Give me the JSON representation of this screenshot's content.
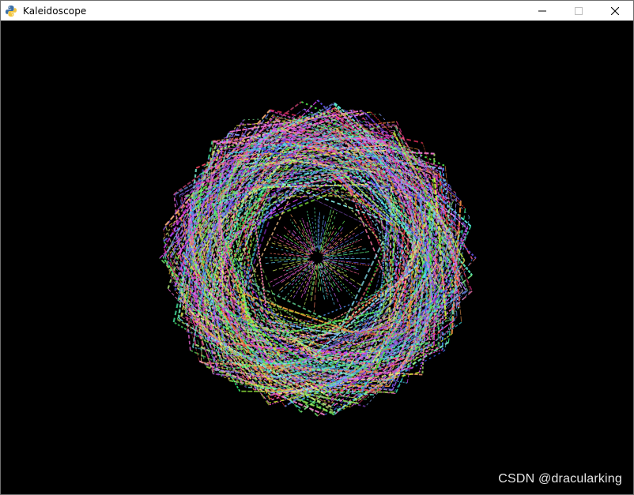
{
  "window": {
    "title": "Kaleidoscope",
    "app_icon": "python-snake-icon",
    "controls": {
      "minimize_icon": "minimize-icon",
      "maximize_icon": "maximize-icon",
      "close_icon": "close-icon"
    }
  },
  "canvas": {
    "background": "#000000",
    "pattern": "rainbow-line-spiral-kaleidoscope",
    "pattern_icon": "kaleidoscope-pattern"
  },
  "watermark": {
    "text": "CSDN @dracularking"
  }
}
